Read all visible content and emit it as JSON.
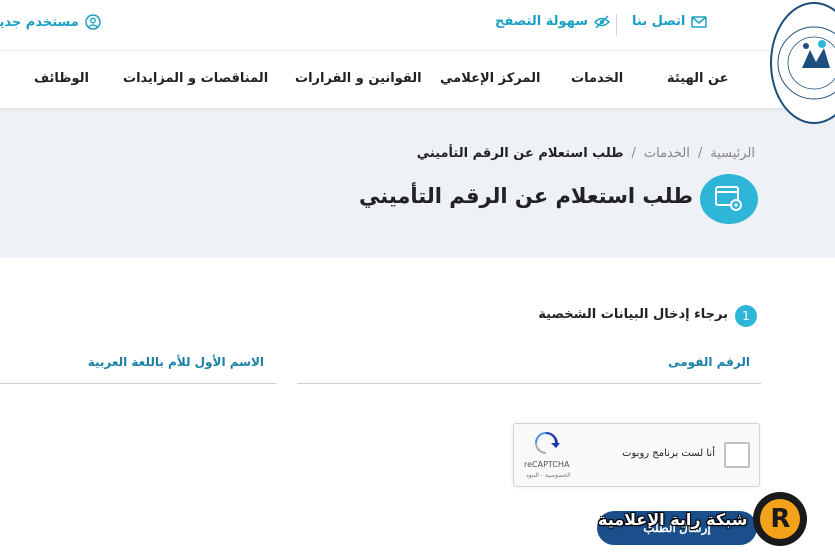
{
  "topbar": {
    "contact": "اتصل بنا",
    "accessibility": "سهولة التصفح",
    "new_user": "مستخدم جديد"
  },
  "nav": {
    "items": [
      "عن الهيئة",
      "الخدمات",
      "المركز الإعلامي",
      "القوانين و القرارات",
      "المناقصات و المزايدات",
      "الوظائف"
    ]
  },
  "breadcrumb": {
    "home": "الرئيسية",
    "services": "الخدمات",
    "current": "طلب استعلام عن الرقم التأميني"
  },
  "page": {
    "title": "طلب استعلام عن الرقم التأميني"
  },
  "form": {
    "step_number": "1",
    "step_text": "برجاء إدخال البيانات الشخصية",
    "national_id_label": "الرقم القومى",
    "mother_name_label": "الاسم الأول للأم باللغة العربية",
    "recaptcha_label": "أنا لست برنامج روبوت",
    "recaptcha_name": "reCAPTCHA",
    "recaptcha_terms": "الخصوصية - البنود",
    "submit_label": "إرسال الطلب"
  },
  "watermark": {
    "text": "شبكة راية الإعلامية",
    "letter": "R"
  },
  "colors": {
    "accent": "#2eb6d8",
    "link": "#1aa0c4",
    "primary": "#1a4f8c",
    "hero_bg": "#eef1f5"
  }
}
